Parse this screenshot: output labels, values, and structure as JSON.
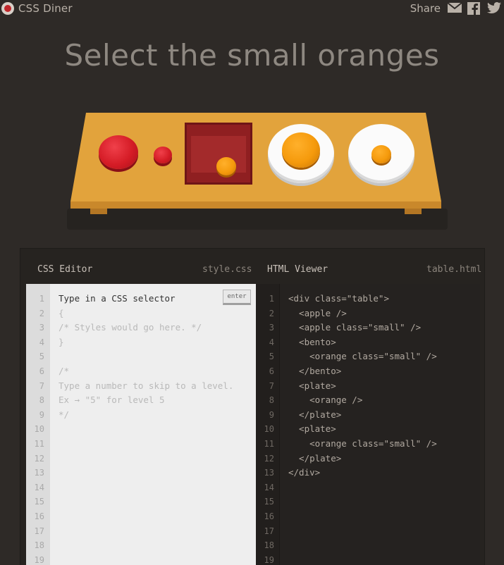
{
  "app": {
    "logo_text": "CSS Diner"
  },
  "share": {
    "label": "Share",
    "icons": [
      "email-icon",
      "facebook-icon",
      "twitter-icon"
    ]
  },
  "level": {
    "title": "Select the small oranges"
  },
  "editor": {
    "css_label": "CSS Editor",
    "css_file": "style.css",
    "html_label": "HTML Viewer",
    "html_file": "table.html",
    "enter_label": "enter",
    "css_lines": [
      "Type in a CSS selector",
      "{",
      "/* Styles would go here. */",
      "}",
      "",
      "/*",
      "Type a number to skip to a level.",
      "Ex → \"5\" for level 5",
      "*/"
    ],
    "html_lines": [
      "<div class=\"table\">",
      "  <apple />",
      "  <apple class=\"small\" />",
      "  <bento>",
      "    <orange class=\"small\" />",
      "  </bento>",
      "  <plate>",
      "    <orange />",
      "  </plate>",
      "  <plate>",
      "    <orange class=\"small\" />",
      "  </plate>",
      "</div>"
    ],
    "line_numbers": [
      "1",
      "2",
      "3",
      "4",
      "5",
      "6",
      "7",
      "8",
      "9",
      "10",
      "11",
      "12",
      "13",
      "14",
      "15",
      "16",
      "17",
      "18",
      "19"
    ]
  },
  "colors": {
    "background": "#2e2a27",
    "table": "#e2a33c",
    "apple": "#d51c26",
    "orange": "#f59a0c"
  }
}
